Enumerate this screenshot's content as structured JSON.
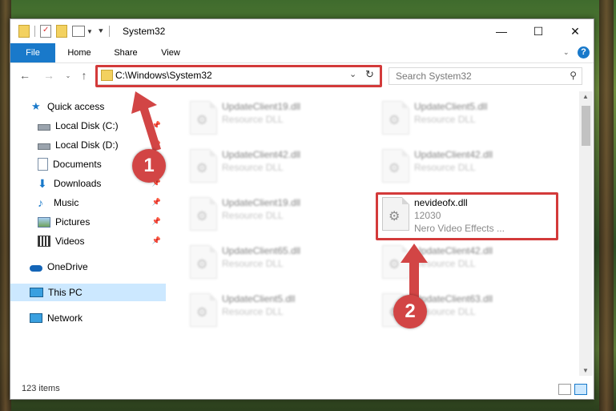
{
  "window": {
    "title": "System32",
    "minimize_glyph": "—",
    "maximize_glyph": "☐",
    "close_glyph": "✕"
  },
  "ribbon": {
    "tabs": [
      "File",
      "Home",
      "Share",
      "View"
    ],
    "help_glyph": "?"
  },
  "address": {
    "path": "C:\\Windows\\System32",
    "search_placeholder": "Search System32"
  },
  "sidebar": {
    "items": [
      {
        "label": "Quick access",
        "icon": "star-icon"
      },
      {
        "label": "Local Disk (C:)",
        "icon": "drive-icon"
      },
      {
        "label": "Local Disk (D:)",
        "icon": "drive-icon"
      },
      {
        "label": "Documents",
        "icon": "documents-icon"
      },
      {
        "label": "Downloads",
        "icon": "downloads-icon"
      },
      {
        "label": "Music",
        "icon": "music-icon"
      },
      {
        "label": "Pictures",
        "icon": "pictures-icon"
      },
      {
        "label": "Videos",
        "icon": "videos-icon"
      },
      {
        "label": "OneDrive",
        "icon": "cloud-icon"
      },
      {
        "label": "This PC",
        "icon": "computer-icon"
      },
      {
        "label": "Network",
        "icon": "network-icon"
      }
    ],
    "selected": "This PC"
  },
  "files": [
    {
      "name": "UpdateClient19.dll",
      "line2": "Resource DLL"
    },
    {
      "name": "UpdateClient5.dll",
      "line2": "Resource DLL"
    },
    {
      "name": "UpdateClient42.dll",
      "line2": "Resource DLL"
    },
    {
      "name": "UpdateClient42.dll",
      "line2": "Resource DLL"
    },
    {
      "name": "UpdateClient19.dll",
      "line2": "Resource DLL"
    },
    {
      "name": "nevideofx.dll",
      "line2": "12030",
      "line3": "Nero Video Effects ..."
    },
    {
      "name": "UpdateClient65.dll",
      "line2": "Resource DLL"
    },
    {
      "name": "UpdateClient42.dll",
      "line2": "Resource DLL"
    },
    {
      "name": "UpdateClient5.dll",
      "line2": "Resource DLL"
    },
    {
      "name": "UpdateClient63.dll",
      "line2": "Resource DLL"
    }
  ],
  "status": {
    "item_count": "123 items"
  },
  "annotations": {
    "step1": "1",
    "step2": "2",
    "accent": "#d33a3a"
  }
}
